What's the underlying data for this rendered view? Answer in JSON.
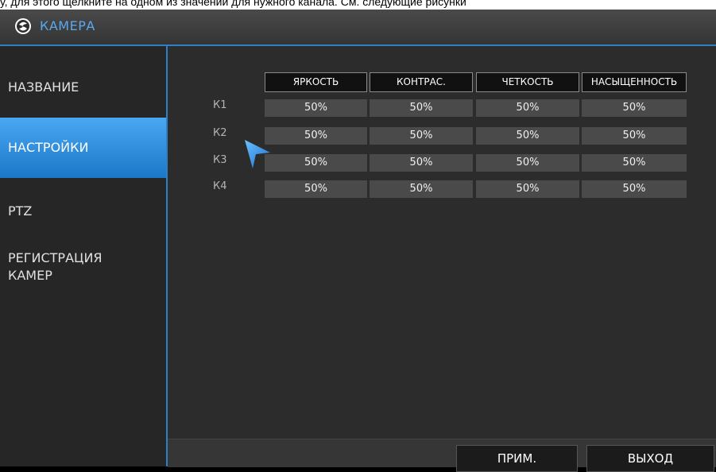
{
  "caption": "у, для этого щелкните на одном из значений для нужного канала. См. следующие рисунки",
  "window": {
    "title": "КАМЕРА",
    "logo_icon": "camera-logo-icon"
  },
  "sidebar": {
    "items": [
      {
        "label": "НАЗВАНИЕ",
        "active": false
      },
      {
        "label": "НАСТРОЙКИ",
        "active": true
      },
      {
        "label": "PTZ",
        "active": false
      },
      {
        "label": "РЕГИСТРАЦИЯ",
        "label2": "КАМЕР",
        "active": false
      }
    ]
  },
  "table": {
    "headers": [
      "ЯРКОСТЬ",
      "КОНТРАС.",
      "ЧЕТКОСТЬ",
      "НАСЫЩЕННОСТЬ"
    ],
    "rows": [
      {
        "label": "К1",
        "values": [
          "50%",
          "50%",
          "50%",
          "50%"
        ]
      },
      {
        "label": "К2",
        "values": [
          "50%",
          "50%",
          "50%",
          "50%"
        ]
      },
      {
        "label": "К3",
        "values": [
          "50%",
          "50%",
          "50%",
          "50%"
        ]
      },
      {
        "label": "К4",
        "values": [
          "50%",
          "50%",
          "50%",
          "50%"
        ]
      }
    ]
  },
  "buttons": {
    "apply": "ПРИМ.",
    "exit": "ВЫХОД"
  },
  "colors": {
    "accent": "#2f7fc4",
    "active_item": "#2b8ee0",
    "title_text": "#5aa9ec"
  }
}
